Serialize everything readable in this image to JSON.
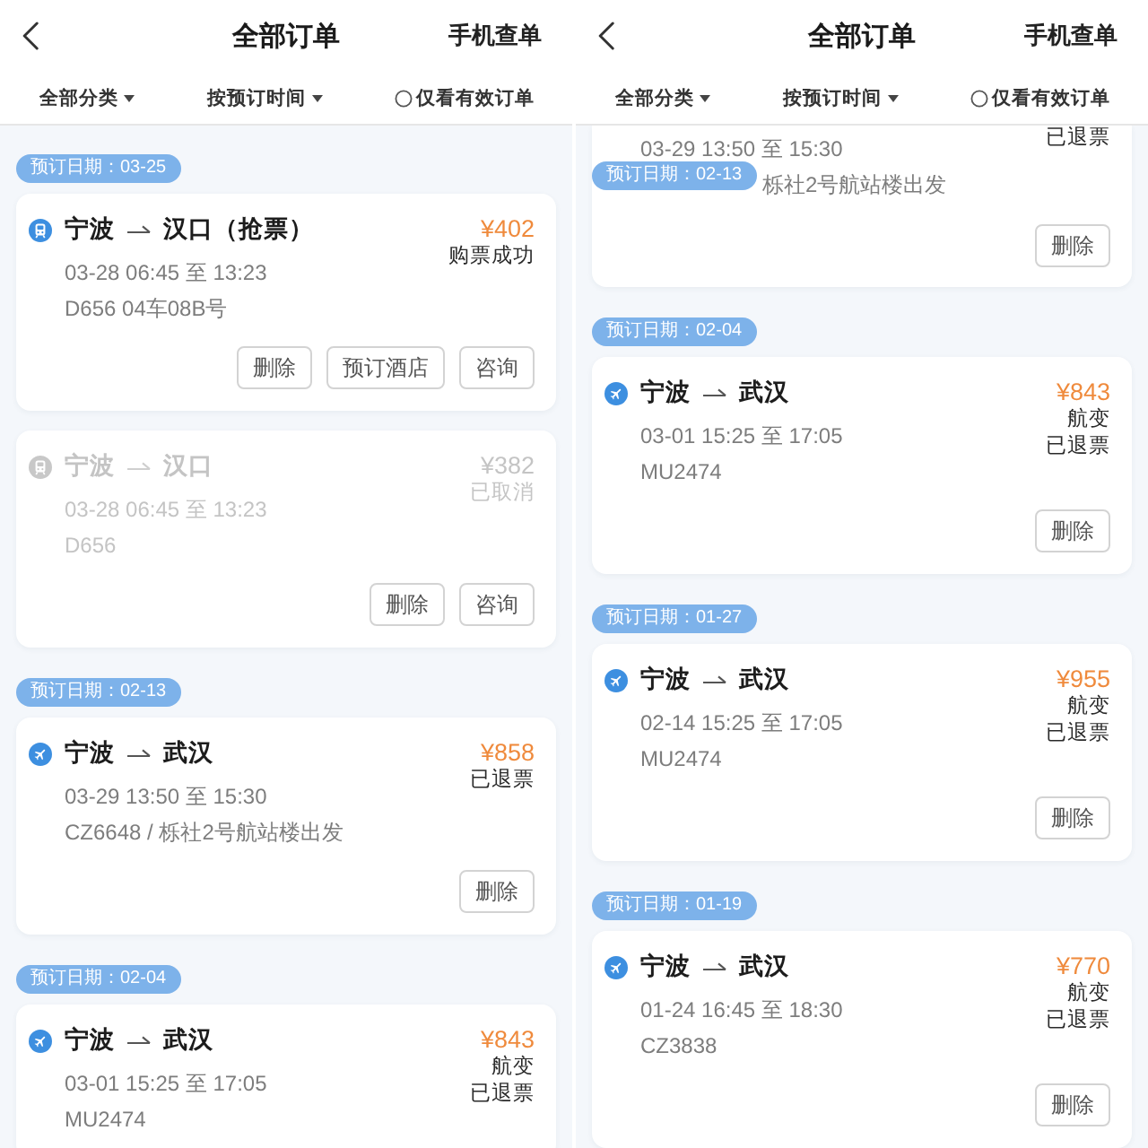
{
  "panels": [
    {
      "header": {
        "title": "全部订单",
        "action": "手机查单"
      },
      "filters": [
        {
          "kind": "dropdown",
          "label": "全部分类"
        },
        {
          "kind": "dropdown",
          "label": "按预订时间"
        },
        {
          "kind": "toggle",
          "label": "仅看有效订单",
          "checked": false
        }
      ],
      "groups": [
        {
          "date_badge": "预订日期：03-25",
          "orders": [
            {
              "kind": "train",
              "from": "宁波",
              "to": "汉口（抢票）",
              "price": "¥402",
              "status": [
                "购票成功"
              ],
              "time": "03-28 06:45 至 13:23",
              "detail": "D656 04车08B号",
              "cancelled": false,
              "buttons": [
                "删除",
                "预订酒店",
                "咨询"
              ]
            },
            {
              "kind": "train",
              "from": "宁波",
              "to": "汉口",
              "price": "¥382",
              "status": [
                "已取消"
              ],
              "time": "03-28 06:45 至 13:23",
              "detail": "D656",
              "cancelled": true,
              "buttons": [
                "删除",
                "咨询"
              ]
            }
          ]
        },
        {
          "date_badge": "预订日期：02-13",
          "orders": [
            {
              "kind": "flight",
              "from": "宁波",
              "to": "武汉",
              "price": "¥858",
              "status": [
                "已退票"
              ],
              "time": "03-29 13:50 至 15:30",
              "detail": "CZ6648 / 栎社2号航站楼出发",
              "cancelled": false,
              "buttons": [
                "删除"
              ]
            }
          ]
        },
        {
          "date_badge": "预订日期：02-04",
          "orders": [
            {
              "kind": "flight",
              "from": "宁波",
              "to": "武汉",
              "price": "¥843",
              "status": [
                "航变",
                "已退票"
              ],
              "time": "03-01 15:25 至 17:05",
              "detail": "MU2474",
              "cancelled": false
            }
          ]
        }
      ]
    },
    {
      "header": {
        "title": "全部订单",
        "action": "手机查单"
      },
      "filters": [
        {
          "kind": "dropdown",
          "label": "全部分类"
        },
        {
          "kind": "dropdown",
          "label": "按预订时间"
        },
        {
          "kind": "toggle",
          "label": "仅看有效订单",
          "checked": false
        }
      ],
      "partial_card": {
        "status": [
          "已退票"
        ],
        "time": "03-29 13:50 至 15:30",
        "detail": "栎社2号航站楼出发",
        "buttons": [
          "删除"
        ]
      },
      "sticky_date_badge": "预订日期：02-13",
      "groups": [
        {
          "date_badge": "预订日期：02-04",
          "orders": [
            {
              "kind": "flight",
              "from": "宁波",
              "to": "武汉",
              "price": "¥843",
              "status": [
                "航变",
                "已退票"
              ],
              "time": "03-01 15:25 至 17:05",
              "detail": "MU2474",
              "cancelled": false,
              "buttons": [
                "删除"
              ]
            }
          ]
        },
        {
          "date_badge": "预订日期：01-27",
          "orders": [
            {
              "kind": "flight",
              "from": "宁波",
              "to": "武汉",
              "price": "¥955",
              "status": [
                "航变",
                "已退票"
              ],
              "time": "02-14 15:25 至 17:05",
              "detail": "MU2474",
              "cancelled": false,
              "buttons": [
                "删除"
              ]
            }
          ]
        },
        {
          "date_badge": "预订日期：01-19",
          "orders": [
            {
              "kind": "flight",
              "from": "宁波",
              "to": "武汉",
              "price": "¥770",
              "status": [
                "航变",
                "已退票"
              ],
              "time": "01-24 16:45 至 18:30",
              "detail": "CZ3838",
              "cancelled": false,
              "buttons": [
                "删除"
              ]
            }
          ]
        }
      ]
    }
  ]
}
